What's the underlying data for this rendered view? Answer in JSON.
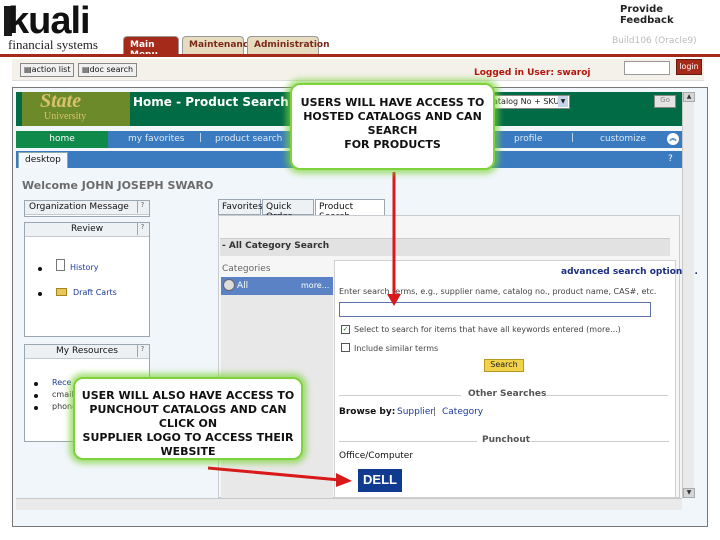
{
  "header": {
    "logo": "kuali",
    "logo_sub": "financial systems",
    "provide_feedback": "Provide Feedback",
    "tabs": [
      "Main Menu",
      "Maintenance",
      "Administration"
    ],
    "env": "Build106 (Oracle9)",
    "logged_in": "Logged in User: swaroj",
    "login_button": "login"
  },
  "toolbar": {
    "action_list": "action list",
    "doc_search": "doc search"
  },
  "app": {
    "university": "State",
    "university_sub": "University",
    "page_heading": "Home - Product Search",
    "catalog_select": "atalog No + SKU)",
    "go": "Go",
    "nav": [
      "home",
      "my favorites",
      "product search",
      "profile",
      "customize"
    ],
    "desktop_tab": "desktop",
    "welcome": "Welcome JOHN JOSEPH SWARO",
    "org_message": "Organization Message",
    "review": {
      "title": "Review",
      "items": [
        "History",
        "Draft Carts"
      ]
    },
    "resources": {
      "title": "My Resources",
      "items": [
        "Rece",
        "cmail",
        "phone"
      ]
    }
  },
  "product_search": {
    "tabs": [
      "Favorites",
      "Quick Order",
      "Product Search"
    ],
    "heading": "- All Category Search",
    "categories_label": "Categories",
    "all": "All",
    "more": "more...",
    "advanced": "advanced search options...",
    "enter_search": "Enter search terms, e.g., supplier name, catalog no., product name, CAS#, etc.",
    "check1": "Select to search for items that have all keywords entered (more...)",
    "check2": "Include similar terms",
    "search_button": "Search",
    "other_searches": "Other Searches",
    "browse_by": "Browse by:",
    "browse_supplier": "Supplier",
    "browse_sep": "|",
    "browse_category": "Category",
    "punchout": "Punchout",
    "office": "Office/Computer",
    "dell": "DELL"
  },
  "callouts": {
    "top": [
      "USERS WILL HAVE ACCESS TO",
      "HOSTED CATALOGS AND CAN SEARCH",
      "FOR PRODUCTS"
    ],
    "bottom": [
      "USER WILL ALSO HAVE ACCESS TO",
      "PUNCHOUT CATALOGS AND CAN CLICK ON",
      "SUPPLIER LOGO TO ACCESS THEIR WEBSITE"
    ]
  },
  "colors": {
    "kuali_red": "#a62a1a",
    "banner_green": "#006b45",
    "nav_blue": "#3a7bbf",
    "callout_glow": "#7fd33a",
    "arrow_red": "#d8181a"
  }
}
